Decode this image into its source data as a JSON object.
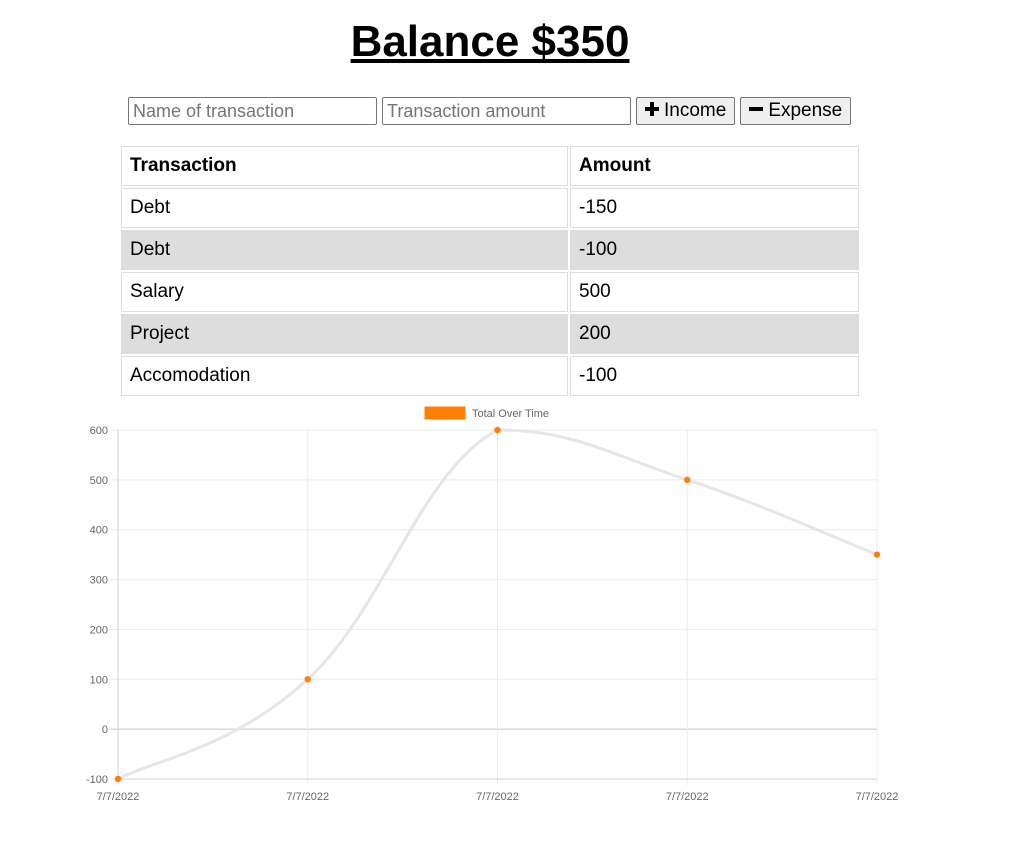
{
  "header": {
    "balance_label": "Balance $350"
  },
  "form": {
    "name_placeholder": "Name of transaction",
    "amount_placeholder": "Transaction amount",
    "income_label": "Income",
    "expense_label": "Expense",
    "income_icon": "plus-icon",
    "expense_icon": "minus-icon"
  },
  "table": {
    "headers": [
      "Transaction",
      "Amount"
    ],
    "rows": [
      {
        "name": "Debt",
        "amount": "-150"
      },
      {
        "name": "Debt",
        "amount": "-100"
      },
      {
        "name": "Salary",
        "amount": "500"
      },
      {
        "name": "Project",
        "amount": "200"
      },
      {
        "name": "Accomodation",
        "amount": "-100"
      }
    ]
  },
  "chart_data": {
    "type": "line",
    "legend": "Total Over Time",
    "legend_color": "#ff7f00",
    "line_color": "#e6e6e6",
    "x": [
      "7/7/2022",
      "7/7/2022",
      "7/7/2022",
      "7/7/2022",
      "7/7/2022"
    ],
    "series": [
      {
        "name": "Total Over Time",
        "values": [
          -100,
          100,
          600,
          500,
          350
        ]
      }
    ],
    "ylim": [
      -100,
      600
    ],
    "yticks": [
      600,
      500,
      400,
      300,
      200,
      100,
      0,
      -100
    ],
    "grid": true,
    "legend_position": "top"
  }
}
